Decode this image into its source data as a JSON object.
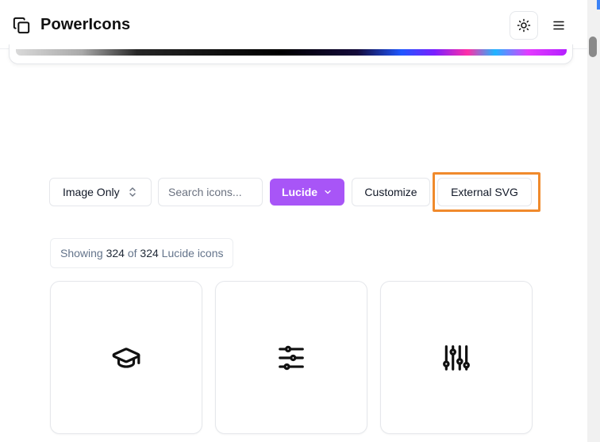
{
  "header": {
    "app_title": "PowerIcons",
    "logo_icon": "copy-icon",
    "theme_toggle_icon": "sun-icon",
    "menu_icon": "menu-icon"
  },
  "toolbar": {
    "view_select_value": "Image Only",
    "search_placeholder": "Search icons...",
    "library_button": "Lucide",
    "customize_button": "Customize",
    "external_svg_button": "External SVG"
  },
  "results": {
    "prefix": "Showing",
    "shown": "324",
    "of": "of",
    "total": "324",
    "suffix": "Lucide icons"
  },
  "icons": [
    {
      "name": "graduation-cap-icon"
    },
    {
      "name": "sliders-horizontal-icon"
    },
    {
      "name": "sliders-vertical-icon"
    }
  ],
  "colors": {
    "accent": "#a855f7",
    "highlight": "#f08a2c",
    "border": "#e5e7eb"
  }
}
